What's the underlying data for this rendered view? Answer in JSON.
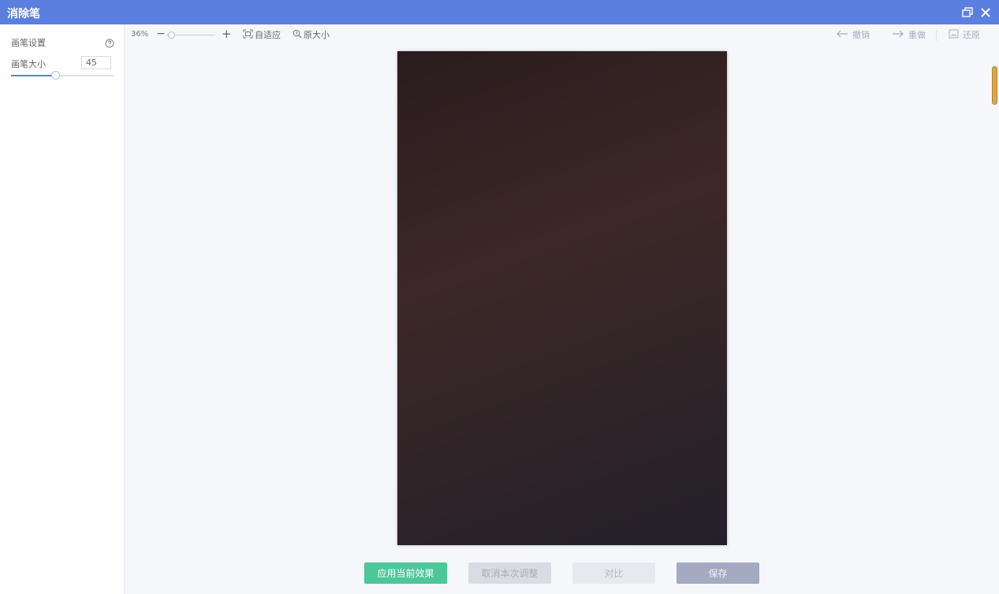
{
  "window": {
    "title": "消除笔",
    "restore_icon": "window-restore-icon",
    "close_icon": "close-icon"
  },
  "sidebar": {
    "section_title": "画笔设置",
    "help_icon": "help-circle-icon",
    "brush_size_label": "画笔大小",
    "brush_size_value": "45",
    "brush_size_fraction": 0.43
  },
  "toolbar": {
    "zoom_level": "36%",
    "zoom_minus_label": "−",
    "zoom_plus_label": "+",
    "fit_label": "自适应",
    "original_size_label": "原大小",
    "undo_label": "撤销",
    "redo_label": "重做",
    "restore_label": "还原"
  },
  "actions": {
    "apply_label": "应用当前效果",
    "cancel_label": "取消本次调整",
    "compare_label": "对比",
    "save_label": "保存"
  },
  "colors": {
    "titlebar": "#5b7fe0",
    "apply": "#4cc79a",
    "save": "#a3aac2"
  }
}
